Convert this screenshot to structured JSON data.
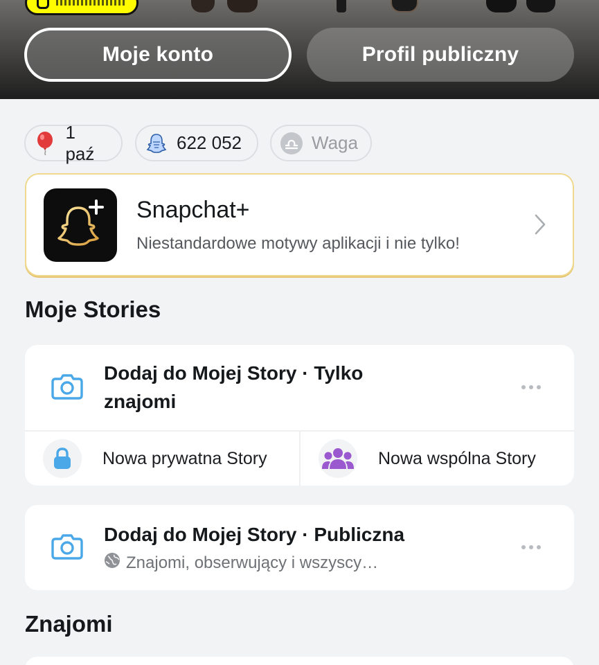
{
  "header": {
    "my_account_label": "Moje konto",
    "public_profile_label": "Profil publiczny"
  },
  "chips": {
    "birthday": {
      "icon": "balloon-icon",
      "label": "1 paź"
    },
    "snap_score": {
      "icon": "snap-score-ghost-icon",
      "label": "622 052"
    },
    "zodiac": {
      "icon": "libra-icon",
      "label": "Waga"
    }
  },
  "snapchat_plus": {
    "title": "Snapchat+",
    "subtitle": "Niestandardowe motywy aplikacji i nie tylko!",
    "icon": "snapchat-plus-logo"
  },
  "my_stories": {
    "section_title": "Moje Stories",
    "friends_story": {
      "title": "Dodaj do Mojej Story · Tylko znajomi",
      "icon": "camera-icon"
    },
    "new_private_story": {
      "label": "Nowa prywatna Story",
      "icon": "lock-icon"
    },
    "new_shared_story": {
      "label": "Nowa wspólna Story",
      "icon": "group-icon"
    },
    "public_story": {
      "title": "Dodaj do Mojej Story · Publiczna",
      "subtitle": "Znajomi, obserwujący i wszyscy…",
      "icon": "camera-icon",
      "subtitle_icon": "globe-icon"
    }
  },
  "friends": {
    "section_title": "Znajomi"
  },
  "colors": {
    "snap_yellow": "#fffc00",
    "story_blue": "#4aa8e8",
    "shared_purple": "#9b59d0",
    "plus_gold": "#e8c46a"
  }
}
